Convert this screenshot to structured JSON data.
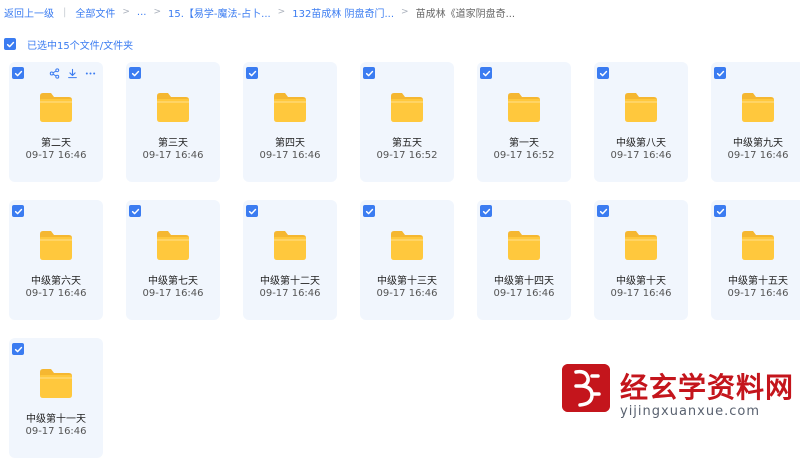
{
  "colors": {
    "accent": "#3b7cf1",
    "folder": "#ffc83d",
    "watermark": "#c4151c"
  },
  "breadcrumb": {
    "back": "返回上一级",
    "root": "全部文件",
    "ellipsis": "...",
    "level1": "15.【易学-魔法-占卜...",
    "level2": "132苗成林 阴盘奇门...",
    "current": "苗成林《道家阴盘奇..."
  },
  "selection": {
    "label": "已选中15个文件/文件夹",
    "icon": "checkbox-checked-icon"
  },
  "tile_actions": {
    "share": "share-icon",
    "download": "download-icon",
    "more": "more-icon"
  },
  "files": [
    {
      "name": "第二天",
      "date": "09-17 16:46"
    },
    {
      "name": "第三天",
      "date": "09-17 16:46"
    },
    {
      "name": "第四天",
      "date": "09-17 16:46"
    },
    {
      "name": "第五天",
      "date": "09-17 16:52"
    },
    {
      "name": "第一天",
      "date": "09-17 16:52"
    },
    {
      "name": "中级第八天",
      "date": "09-17 16:46"
    },
    {
      "name": "中级第九天",
      "date": "09-17 16:46"
    },
    {
      "name": "中级第六天",
      "date": "09-17 16:46"
    },
    {
      "name": "中级第七天",
      "date": "09-17 16:46"
    },
    {
      "name": "中级第十二天",
      "date": "09-17 16:46"
    },
    {
      "name": "中级第十三天",
      "date": "09-17 16:46"
    },
    {
      "name": "中级第十四天",
      "date": "09-17 16:46"
    },
    {
      "name": "中级第十天",
      "date": "09-17 16:46"
    },
    {
      "name": "中级第十五天",
      "date": "09-17 16:46"
    },
    {
      "name": "中级第十一天",
      "date": "09-17 16:46"
    }
  ],
  "watermark": {
    "title": "经玄学资料网",
    "url": "yijingxuanxue.com"
  }
}
